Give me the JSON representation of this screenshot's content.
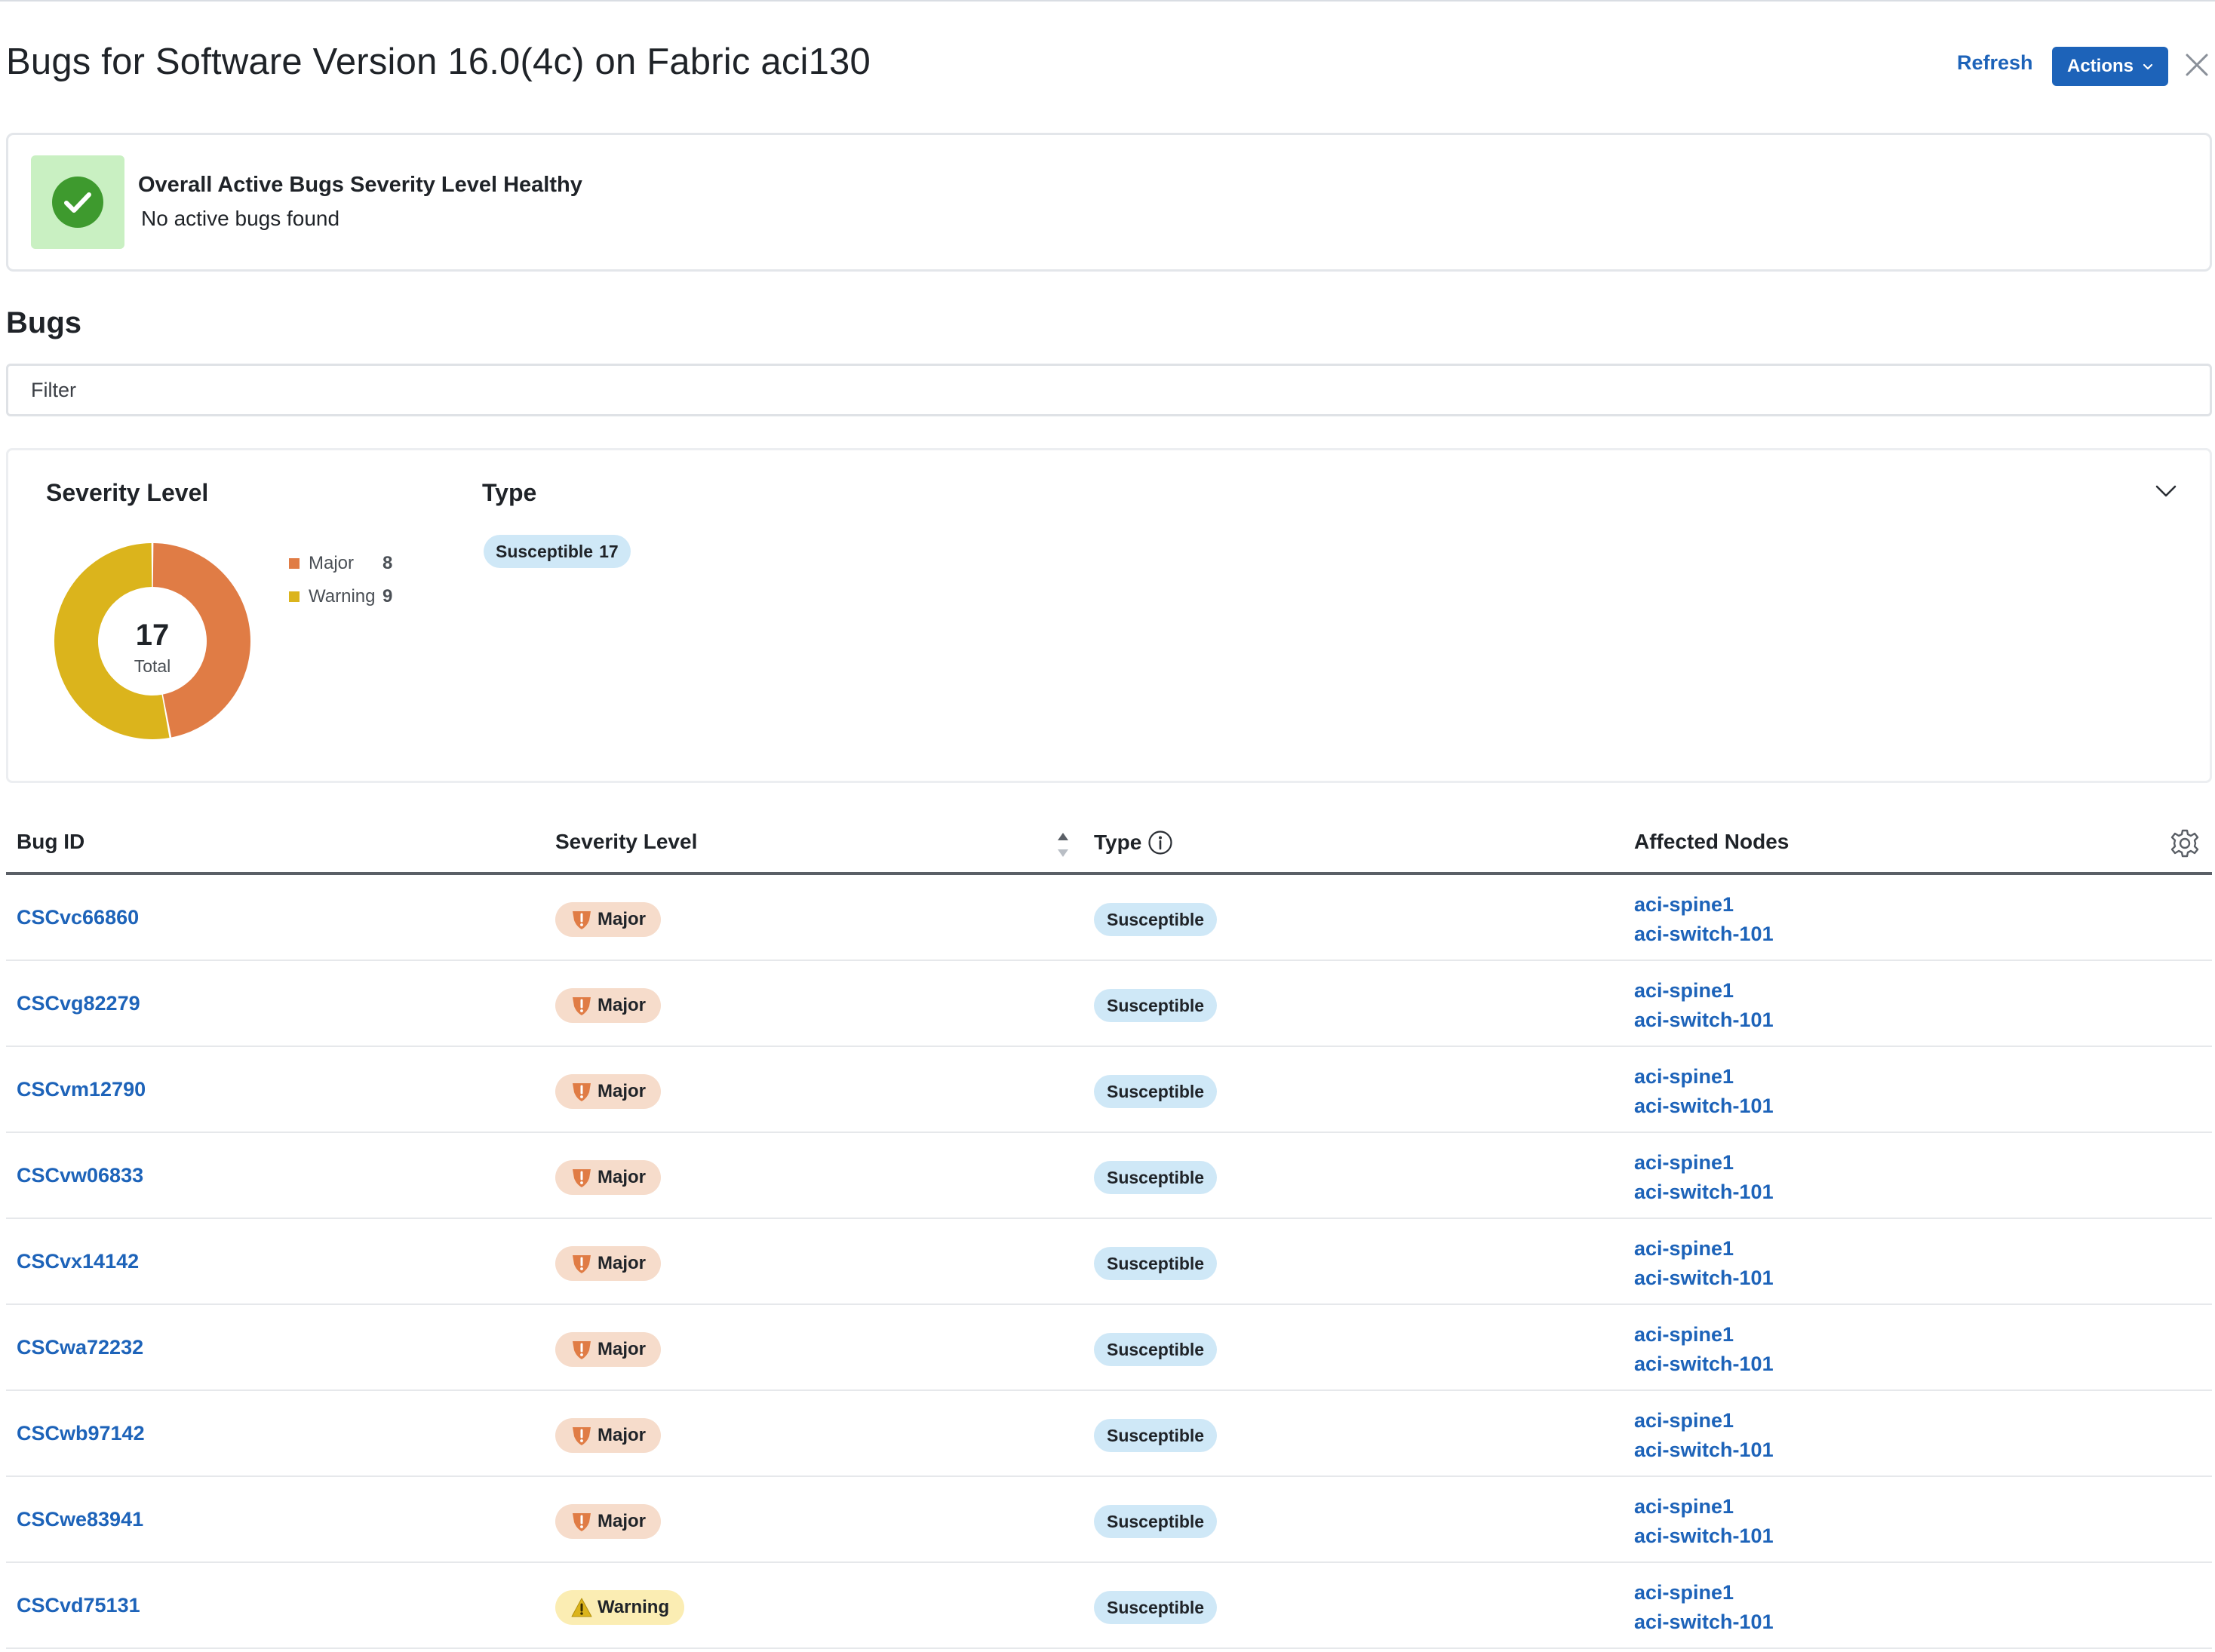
{
  "header": {
    "title": "Bugs for Software Version 16.0(4c) on Fabric aci130",
    "refresh_label": "Refresh",
    "actions_label": "Actions"
  },
  "health": {
    "title": "Overall Active Bugs Severity Level Healthy",
    "subtitle": "No active bugs found",
    "status_color": "#3e9a2e"
  },
  "bugs_section": {
    "title": "Bugs",
    "filter_placeholder": "Filter"
  },
  "summary": {
    "severity_title": "Severity Level",
    "type_title": "Type",
    "type_pill": {
      "label": "Susceptible",
      "count": "17"
    }
  },
  "chart_data": {
    "type": "pie",
    "categories": [
      "Major",
      "Warning"
    ],
    "values": [
      8,
      9
    ],
    "colors": [
      "#e07c45",
      "#dbb41c"
    ],
    "center_value": "17",
    "center_label": "Total",
    "legend_position": "right"
  },
  "table": {
    "columns": [
      "Bug ID",
      "Severity Level",
      "Type",
      "Affected Nodes"
    ],
    "rows": [
      {
        "id": "CSCvc66860",
        "severity": "Major",
        "type": "Susceptible",
        "nodes": [
          "aci-spine1",
          "aci-switch-101"
        ]
      },
      {
        "id": "CSCvg82279",
        "severity": "Major",
        "type": "Susceptible",
        "nodes": [
          "aci-spine1",
          "aci-switch-101"
        ]
      },
      {
        "id": "CSCvm12790",
        "severity": "Major",
        "type": "Susceptible",
        "nodes": [
          "aci-spine1",
          "aci-switch-101"
        ]
      },
      {
        "id": "CSCvw06833",
        "severity": "Major",
        "type": "Susceptible",
        "nodes": [
          "aci-spine1",
          "aci-switch-101"
        ]
      },
      {
        "id": "CSCvx14142",
        "severity": "Major",
        "type": "Susceptible",
        "nodes": [
          "aci-spine1",
          "aci-switch-101"
        ]
      },
      {
        "id": "CSCwa72232",
        "severity": "Major",
        "type": "Susceptible",
        "nodes": [
          "aci-spine1",
          "aci-switch-101"
        ]
      },
      {
        "id": "CSCwb97142",
        "severity": "Major",
        "type": "Susceptible",
        "nodes": [
          "aci-spine1",
          "aci-switch-101"
        ]
      },
      {
        "id": "CSCwe83941",
        "severity": "Major",
        "type": "Susceptible",
        "nodes": [
          "aci-spine1",
          "aci-switch-101"
        ]
      },
      {
        "id": "CSCvd75131",
        "severity": "Warning",
        "type": "Susceptible",
        "nodes": [
          "aci-spine1",
          "aci-switch-101"
        ]
      }
    ]
  },
  "icons": {
    "close": "close-icon",
    "check": "check-circle-icon",
    "collapse": "chevron-down-icon",
    "sort": "sort-icon",
    "info": "info-icon",
    "settings": "gear-icon",
    "major": "shield-exclamation-icon",
    "warning": "warning-triangle-icon"
  },
  "colors": {
    "accent": "#1d63b9",
    "major": "#e07c45",
    "warning": "#dbb41c",
    "susceptible_bg": "#cfe8f7"
  }
}
